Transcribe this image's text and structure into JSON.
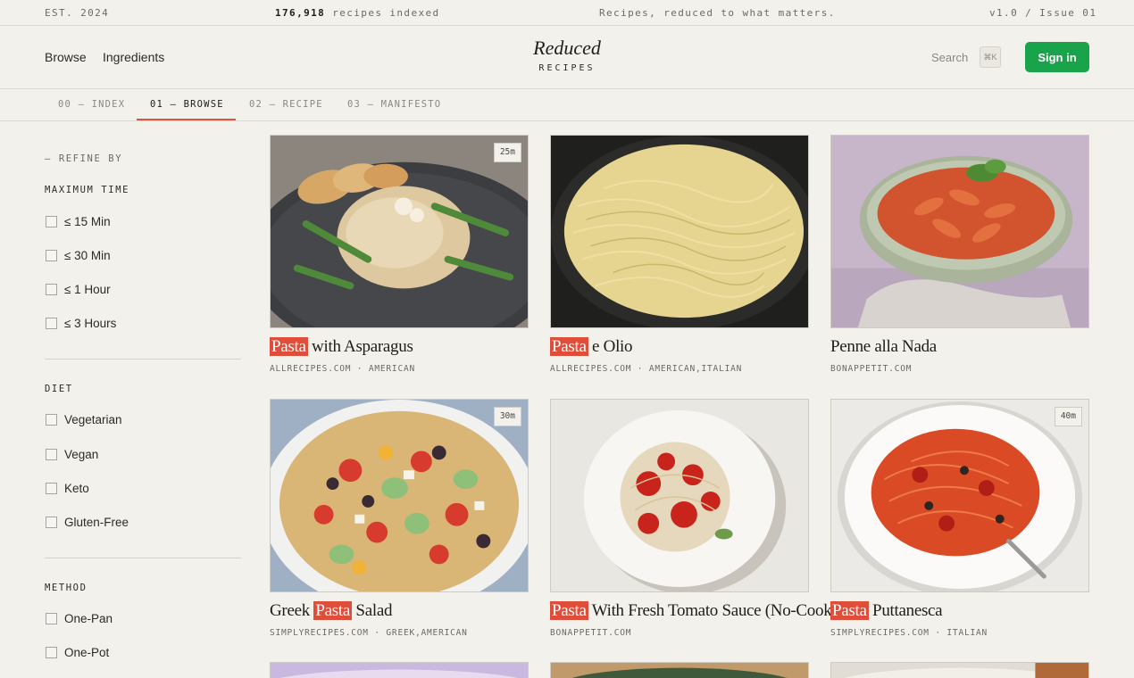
{
  "topbar": {
    "est": "EST. 2024",
    "count": "176,918",
    "count_label": "recipes indexed",
    "tagline": "Recipes, reduced to what matters.",
    "version": "v1.0 / Issue 01"
  },
  "header": {
    "nav": [
      "Browse",
      "Ingredients"
    ],
    "brand": "Reduced",
    "brand_sub": "RECIPES",
    "search_label": "Search",
    "search_shortcut": "⌘K",
    "signin_label": "Sign in",
    "accent_color": "#19a34a"
  },
  "tabs": {
    "items": [
      "00 — INDEX",
      "01 — BROWSE",
      "02 — RECIPE",
      "03 — MANIFESTO"
    ],
    "active": "01 — BROWSE",
    "underline_color": "#e0533d"
  },
  "sidebar": {
    "refine": "— REFINE BY",
    "groups": [
      {
        "title": "MAXIMUM TIME",
        "options": [
          "≤ 15 Min",
          "≤ 30 Min",
          "≤ 1 Hour",
          "≤ 3 Hours"
        ]
      },
      {
        "title": "DIET",
        "options": [
          "Vegetarian",
          "Vegan",
          "Keto",
          "Gluten-Free"
        ]
      },
      {
        "title": "METHOD",
        "options": [
          "One-Pan",
          "One-Pot"
        ]
      }
    ]
  },
  "search_highlight": "Pasta",
  "highlight_color": "#de4e3b",
  "recipes": [
    {
      "time": "25m",
      "title_pre": "",
      "title_hl": "Pasta",
      "title_post": " with Asparagus",
      "source": "ALLRECIPES.COM",
      "cuisine": "AMERICAN",
      "image": "pasta-asparagus-photo"
    },
    {
      "time": "",
      "title_pre": "",
      "title_hl": "Pasta",
      "title_post": " e Olio",
      "source": "ALLRECIPES.COM",
      "cuisine": "AMERICAN,ITALIAN",
      "image": "pasta-olio-photo"
    },
    {
      "time": "",
      "title_pre": "Penne alla Nada",
      "title_hl": "",
      "title_post": "",
      "source": "BONAPPETIT.COM",
      "cuisine": "",
      "image": "penne-photo"
    },
    {
      "time": "30m",
      "title_pre": "Greek ",
      "title_hl": "Pasta",
      "title_post": " Salad",
      "source": "SIMPLYRECIPES.COM",
      "cuisine": "GREEK,AMERICAN",
      "image": "pasta-salad-photo"
    },
    {
      "time": "",
      "title_pre": "",
      "title_hl": "Pasta",
      "title_post": " With Fresh Tomato Sauce (No-Cook)",
      "source": "BONAPPETIT.COM",
      "cuisine": "",
      "image": "tomato-pasta-photo"
    },
    {
      "time": "40m",
      "title_pre": "",
      "title_hl": "Pasta",
      "title_post": " Puttanesca",
      "source": "SIMPLYRECIPES.COM",
      "cuisine": "ITALIAN",
      "image": "puttanesca-photo"
    }
  ]
}
